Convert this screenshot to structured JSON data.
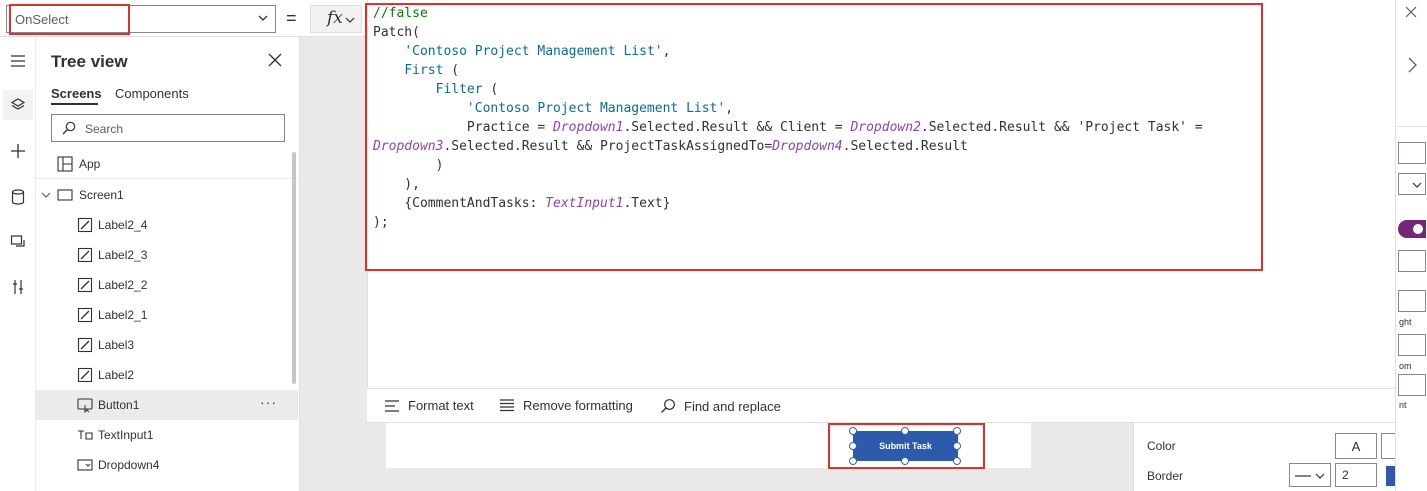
{
  "formula_bar": {
    "property": "OnSelect",
    "equals": "=",
    "fx": "fx"
  },
  "tree": {
    "title": "Tree view",
    "tabs": [
      "Screens",
      "Components"
    ],
    "search_placeholder": "Search",
    "app_label": "App",
    "screen_label": "Screen1",
    "items": [
      {
        "label": "Label2_4",
        "icon": "label-icon"
      },
      {
        "label": "Label2_3",
        "icon": "label-icon"
      },
      {
        "label": "Label2_2",
        "icon": "label-icon"
      },
      {
        "label": "Label2_1",
        "icon": "label-icon"
      },
      {
        "label": "Label3",
        "icon": "label-icon"
      },
      {
        "label": "Label2",
        "icon": "label-icon"
      },
      {
        "label": "Button1",
        "icon": "button-icon"
      },
      {
        "label": "TextInput1",
        "icon": "text-input-icon"
      },
      {
        "label": "Dropdown4",
        "icon": "dropdown-icon"
      }
    ],
    "more": "···"
  },
  "code": {
    "l1": "//false",
    "l2": "Patch(",
    "l3_str": "'Contoso Project Management List'",
    "l4_kw": "First",
    "l5_kw": "Filter",
    "l6_str": "'Contoso Project Management List'",
    "l7_a": "Practice = ",
    "l7_ref1": "Dropdown1",
    "l7_b": ".Selected.Result && Client = ",
    "l7_ref2": "Dropdown2",
    "l7_c": ".Selected.Result && 'Project Task' =",
    "l8_ref3": "Dropdown3",
    "l8_a": ".Selected.Result && ProjectTaskAssignedTo=",
    "l8_ref4": "Dropdown4",
    "l8_b": ".Selected.Result",
    "l11_a": "{CommentAndTasks: ",
    "l11_ref": "TextInput1",
    "l11_b": ".Text}",
    "l12": ");"
  },
  "format_bar": {
    "format_text": "Format text",
    "remove_formatting": "Remove formatting",
    "find_replace": "Find and replace"
  },
  "canvas": {
    "button_text": "Submit Task"
  },
  "properties": {
    "color_label": "Color",
    "color_glyph": "A",
    "border_label": "Border",
    "border_width": "2",
    "border_color": "#2e5aac",
    "frag_ght": "ght",
    "frag_om": "om",
    "frag_nt": "nt"
  },
  "colors": {
    "accent": "#2e5aac",
    "highlight": "#e0302d",
    "toggle": "#742774"
  }
}
